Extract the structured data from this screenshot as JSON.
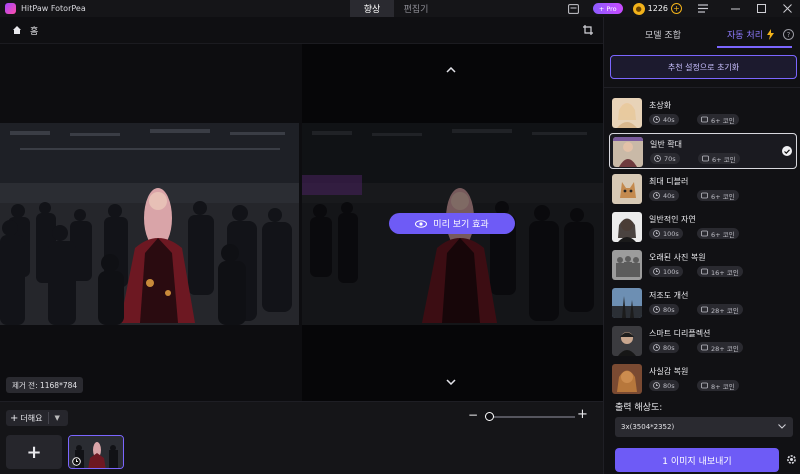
{
  "app": {
    "name": "HitPaw FotorPea"
  },
  "tabs": [
    {
      "label": "향상"
    },
    {
      "label": "편집기"
    }
  ],
  "topbar": {
    "pro_label": "+ Pro",
    "coin_count": "1226"
  },
  "breadcrumb": {
    "label": "홈"
  },
  "canvas": {
    "preview_button_label": "미리 보기 효과",
    "before_size_label": "제거 전: 1168*784"
  },
  "bottombar": {
    "add_more_label": "더해요",
    "zoom_level": 0.0
  },
  "panel": {
    "tabs": [
      {
        "label": "모델 조합"
      },
      {
        "label": "자동 처리"
      }
    ],
    "reset_label": "추천 설정으로 초기화",
    "models": [
      {
        "name": "초상화",
        "time": "40s",
        "cost": "6+ 코인",
        "selected": false
      },
      {
        "name": "일반 확대",
        "time": "70s",
        "cost": "6+ 코인",
        "selected": true
      },
      {
        "name": "최대 디블러",
        "time": "40s",
        "cost": "6+ 코인",
        "selected": false
      },
      {
        "name": "일반적인 자연",
        "time": "100s",
        "cost": "6+ 코인",
        "selected": false
      },
      {
        "name": "오래된 사진 복원",
        "time": "100s",
        "cost": "16+ 코인",
        "selected": false
      },
      {
        "name": "저조도 개선",
        "time": "80s",
        "cost": "28+ 코인",
        "selected": false
      },
      {
        "name": "스마트 디리플렉션",
        "time": "80s",
        "cost": "28+ 코인",
        "selected": false
      },
      {
        "name": "사실감 복원",
        "time": "80s",
        "cost": "8+ 코인",
        "selected": false
      }
    ],
    "resolution_label": "출력 해상도:",
    "resolution_value": "3x(3504*2352)",
    "export_label": "1 이미지 내보내기"
  },
  "colors": {
    "accent": "#6e5bf6",
    "accent_light": "#8f7bff",
    "coin": "#f2b21a"
  }
}
